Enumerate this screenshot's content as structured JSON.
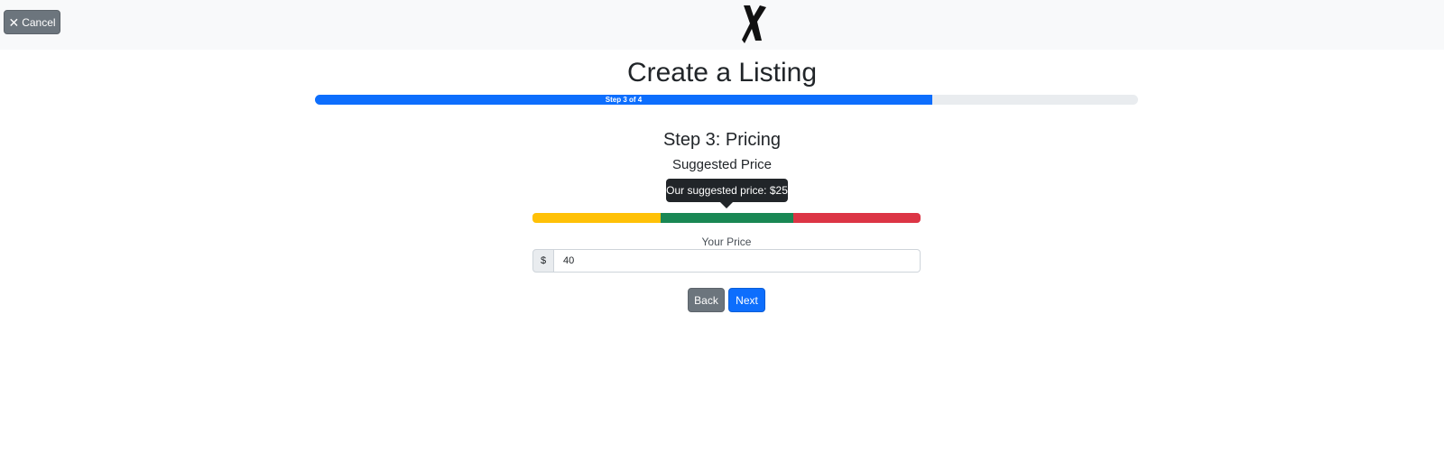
{
  "header": {
    "cancel_label": "Cancel"
  },
  "page": {
    "title": "Create a Listing"
  },
  "progress": {
    "label": "Step 3 of 4",
    "percent": 75,
    "color": "#0d6efd"
  },
  "step": {
    "title": "Step 3: Pricing",
    "subtitle": "Suggested Price"
  },
  "suggestion": {
    "tooltip": "Our suggested price: $25",
    "colors": {
      "low": "#ffc107",
      "mid": "#198754",
      "high": "#dc3545"
    }
  },
  "price": {
    "label": "Your Price",
    "currency": "$",
    "value": "40"
  },
  "actions": {
    "back_label": "Back",
    "next_label": "Next"
  },
  "icons": {
    "cancel": "close-icon",
    "logo": "x-logo-icon"
  }
}
